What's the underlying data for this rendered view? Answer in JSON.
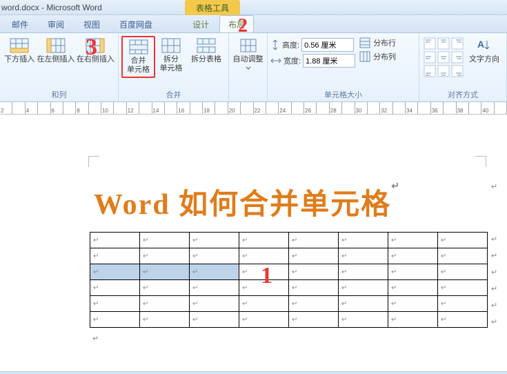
{
  "window": {
    "title": "word.docx - Microsoft Word"
  },
  "contextual_label": "表格工具",
  "tabs": {
    "mail": "邮件",
    "review": "审阅",
    "view": "视图",
    "baidu": "百度网盘",
    "design": "设计",
    "layout": "布局"
  },
  "ribbon": {
    "rows_cols": {
      "below": "下方插入",
      "left": "在左侧插入",
      "right": "在右侧插入",
      "title": "和列"
    },
    "merge": {
      "merge_cells": "合并\n单元格",
      "unmerge": "拆分\n单元格",
      "split_table": "拆分表格",
      "title": "合并"
    },
    "autofit": {
      "label": "自动调整"
    },
    "cellsize": {
      "height_label": "高度:",
      "height_value": "0.56 厘米",
      "width_label": "宽度:",
      "width_value": "1.88 厘米",
      "dist_rows": "分布行",
      "dist_cols": "分布列",
      "title": "单元格大小"
    },
    "align": {
      "textdir": "文字方向",
      "title": "对齐方式"
    }
  },
  "annotations": {
    "a1": "1",
    "a2": "2",
    "a3": "3"
  },
  "document": {
    "title": "Word 如何合并单元格",
    "return_mark": "↵",
    "cell_mark": "↵"
  }
}
